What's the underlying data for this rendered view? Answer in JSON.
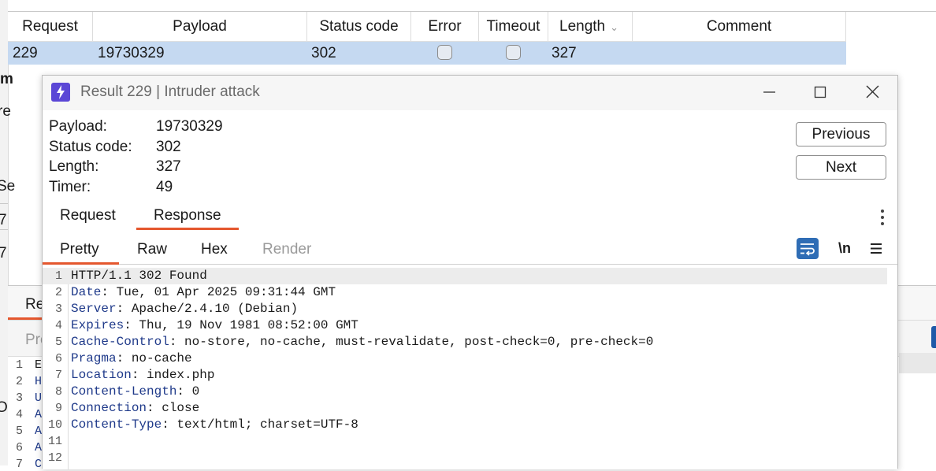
{
  "results_table": {
    "columns": [
      "Request",
      "Payload",
      "Status code",
      "Error",
      "Timeout",
      "Length",
      "Comment"
    ],
    "row": {
      "request": "229",
      "payload": "19730329",
      "status_code": "302",
      "error": false,
      "timeout": false,
      "length": "327",
      "comment": ""
    }
  },
  "background_fragments": {
    "left_chars": [
      "m",
      "re",
      "Se",
      "7",
      "7",
      "O"
    ],
    "lower_tab_label": "Re",
    "lower_subtab_label": "Pre",
    "gutter_numbers": [
      "1",
      "2",
      "3",
      "4",
      "5",
      "6",
      "7"
    ],
    "gutter_chars": [
      "E",
      "H",
      "U",
      "A",
      "A",
      "A",
      "C"
    ]
  },
  "dialog": {
    "title": "Result 229 | Intruder attack",
    "info": [
      {
        "label": "Payload:",
        "value": "19730329"
      },
      {
        "label": "Status code:",
        "value": "302"
      },
      {
        "label": "Length:",
        "value": "327"
      },
      {
        "label": "Timer:",
        "value": "49"
      }
    ],
    "previous_label": "Previous",
    "next_label": "Next",
    "tabs": [
      "Request",
      "Response"
    ],
    "active_tab": "Response",
    "subtabs": [
      "Pretty",
      "Raw",
      "Hex",
      "Render"
    ],
    "active_subtab": "Pretty",
    "newline_toggle_label": "\\n",
    "response_lines": [
      {
        "n": "1",
        "key": "",
        "rest": "HTTP/1.1 302 Found"
      },
      {
        "n": "2",
        "key": "Date",
        "rest": ": Tue, 01 Apr 2025 09:31:44 GMT"
      },
      {
        "n": "3",
        "key": "Server",
        "rest": ": Apache/2.4.10 (Debian)"
      },
      {
        "n": "4",
        "key": "Expires",
        "rest": ": Thu, 19 Nov 1981 08:52:00 GMT"
      },
      {
        "n": "5",
        "key": "Cache-Control",
        "rest": ": no-store, no-cache, must-revalidate, post-check=0, pre-check=0"
      },
      {
        "n": "6",
        "key": "Pragma",
        "rest": ": no-cache"
      },
      {
        "n": "7",
        "key": "Location",
        "rest": ": index.php"
      },
      {
        "n": "8",
        "key": "Content-Length",
        "rest": ": 0"
      },
      {
        "n": "9",
        "key": "Connection",
        "rest": ": close"
      },
      {
        "n": "10",
        "key": "Content-Type",
        "rest": ": text/html; charset=UTF-8"
      },
      {
        "n": "11",
        "key": "",
        "rest": ""
      },
      {
        "n": "12",
        "key": "",
        "rest": ""
      }
    ]
  },
  "colors": {
    "accent_orange": "#e4572e",
    "selected_row": "#c5d9f1",
    "header_key_blue": "#1f3a8a",
    "app_icon_purple": "#5b47d6"
  }
}
